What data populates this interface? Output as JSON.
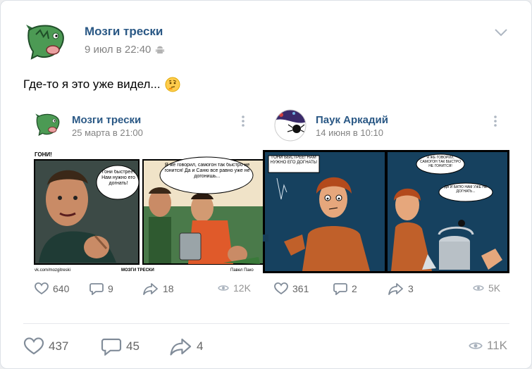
{
  "post": {
    "author": "Мозги трески",
    "time": "9 июл в 22:40",
    "text": "Где-то я это уже видел...",
    "likes": "437",
    "comments": "45",
    "shares": "4",
    "views": "11K"
  },
  "reposts": [
    {
      "author": "Мозги трески",
      "time": "25 марта в 21:00",
      "likes": "640",
      "comments": "9",
      "shares": "18",
      "views": "12K",
      "comic": {
        "title": "ГОНИ!",
        "bubble1": "Гони быстрее! Нам нужно его догнать!",
        "bubble2": "Я же говорил, самогон так быстро не гонится! Да и Саню все равно уже не догонишь...",
        "footer_left": "vk.com/mozgitreski",
        "footer_mid": "МОЗГИ ТРЕСКИ",
        "footer_right": "Павел Пако"
      }
    },
    {
      "author": "Паук Аркадий",
      "time": "14 июня в 10:10",
      "likes": "361",
      "comments": "2",
      "shares": "3",
      "views": "5K",
      "comic": {
        "bubble1": "ГОНИ БЫСТРЕЕ! НАМ НУЖНО ЕГО ДОГНАТЬ!",
        "bubble2": "Я ЖЕ ГОВОРИЛ, САМОГОН ТАК БЫСТРО НЕ ГОНИТСЯ!",
        "bubble3": "ДА И БАТЮ НАМ УЖЕ НЕ ДОГНАТЬ..."
      }
    }
  ],
  "colors": {
    "link": "#2a5885",
    "meta": "#828282",
    "comic_bg2": "#16415f"
  }
}
